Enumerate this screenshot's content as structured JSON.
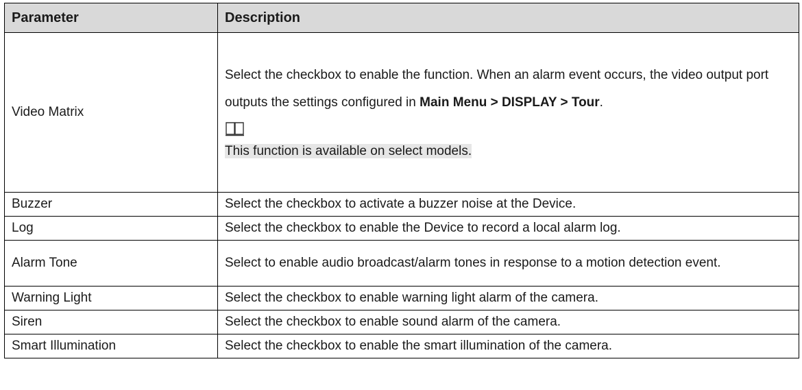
{
  "table": {
    "headers": [
      "Parameter",
      "Description"
    ],
    "rows": [
      {
        "param": "Video Matrix",
        "desc_pre": "Select the checkbox to enable the function. When an alarm event occurs, the video output port outputs the settings configured in ",
        "desc_bold1": "Main Menu > DISPLAY > Tour",
        "desc_post": ".",
        "note_icon": "book-icon",
        "note_text": "This function is available on select models."
      },
      {
        "param": "Buzzer",
        "desc": "Select the checkbox to activate a buzzer noise at the Device."
      },
      {
        "param": "Log",
        "desc": "Select the checkbox to enable the Device to record a local alarm log."
      },
      {
        "param": "Alarm Tone",
        "desc": "Select to enable audio broadcast/alarm tones in response to a motion detection event."
      },
      {
        "param": "Warning Light",
        "desc": "Select the checkbox to enable warning light alarm of the camera."
      },
      {
        "param": "Siren",
        "desc": "Select the checkbox to enable sound alarm of the camera."
      },
      {
        "param": "Smart Illumination",
        "desc": "Select the checkbox to enable the smart illumination of the camera."
      }
    ]
  }
}
